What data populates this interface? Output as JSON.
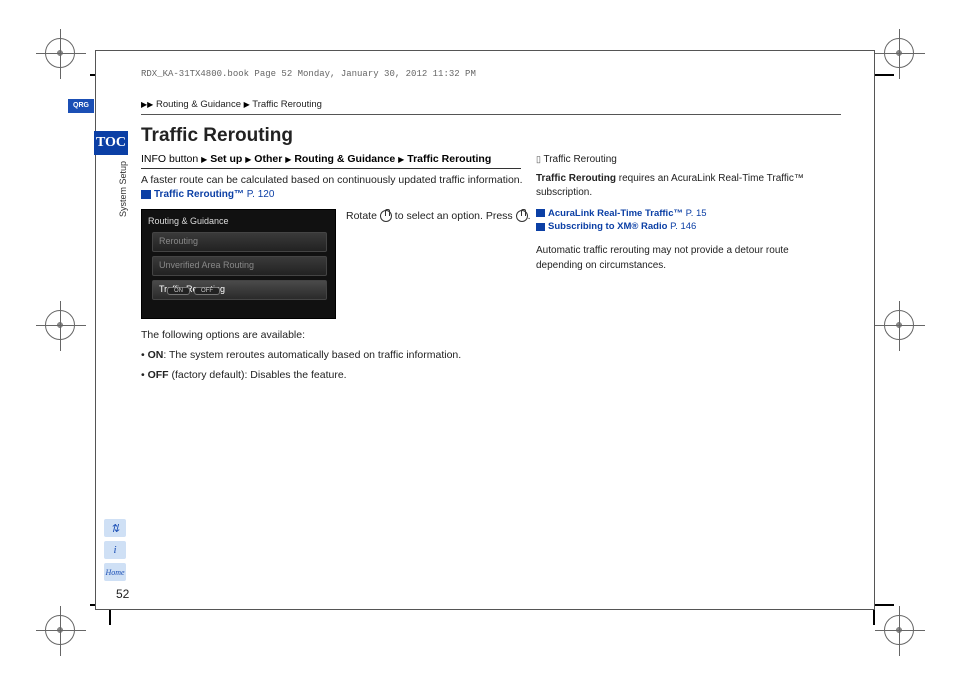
{
  "print_header": "RDX_KA-31TX4800.book  Page 52  Monday, January 30, 2012  11:32 PM",
  "breadcrumb": {
    "a": "Routing & Guidance",
    "b": "Traffic Rerouting"
  },
  "sidebar": {
    "qrg": "QRG",
    "toc": "TOC",
    "vlabel": "System Setup"
  },
  "title": "Traffic Rerouting",
  "nav_path": {
    "prefix": "INFO button",
    "p1": "Set up",
    "p2": "Other",
    "p3": "Routing & Guidance",
    "p4": "Traffic Rerouting"
  },
  "intro": "A faster route can be calculated based on continuously updated traffic information.",
  "link_main": {
    "text": "Traffic Rerouting™",
    "page": "P. 120"
  },
  "screenshot": {
    "bar": "Routing & Guidance",
    "row1": "Rerouting",
    "row2": "Unverified Area Routing",
    "row3": "Traffic Rerouting",
    "on": "ON",
    "off": "OFF"
  },
  "instruction": {
    "a": "Rotate ",
    "b": " to select an option. Press ",
    "c": "."
  },
  "options_intro": "The following options are available:",
  "options": [
    {
      "label": "ON",
      "text": ": The system reroutes automatically based on traffic information."
    },
    {
      "label": "OFF",
      "text": " (factory default): Disables the feature."
    }
  ],
  "side": {
    "heading": "Traffic Rerouting",
    "p1a": "Traffic Rerouting",
    "p1b": " requires an AcuraLink Real-Time Traffic™ subscription.",
    "link1": {
      "text": "AcuraLink Real-Time Traffic™",
      "page": "P. 15"
    },
    "link2": {
      "text": "Subscribing to XM® Radio",
      "page": "P. 146"
    },
    "p2": "Automatic traffic rerouting may not provide a detour route depending on circumstances."
  },
  "foot_icons": {
    "a": "⇅",
    "b": "i",
    "c": "Home"
  },
  "page_number": "52"
}
